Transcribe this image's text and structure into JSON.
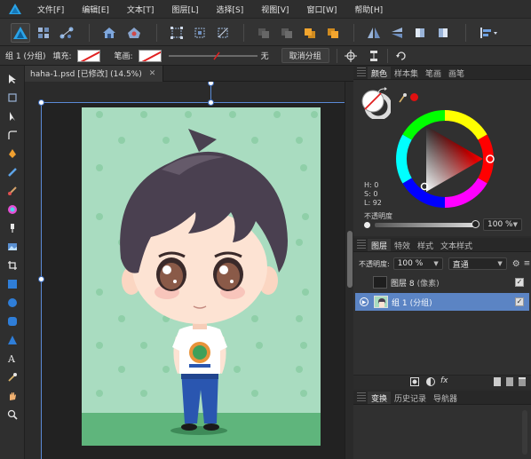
{
  "menubar": {
    "items": [
      "文件[F]",
      "编辑[E]",
      "文本[T]",
      "图层[L]",
      "选择[S]",
      "视图[V]",
      "窗口[W]",
      "帮助[H]"
    ]
  },
  "contextbar": {
    "selection_label": "组 1 (分组)",
    "fill_label": "填充:",
    "stroke_label": "笔画:",
    "stroke_value": "无",
    "ungroup_button": "取消分组"
  },
  "document": {
    "tab_title": "haha-1.psd [已修改] (14.5%)"
  },
  "color_panel": {
    "tabs": [
      "颜色",
      "样本集",
      "笔画",
      "画笔"
    ],
    "hsl": {
      "h": "H: 0",
      "s": "S: 0",
      "l": "L: 92"
    },
    "opacity_label": "不透明度",
    "opacity_value": "100 %"
  },
  "layers_panel": {
    "tabs": [
      "图层",
      "特效",
      "样式",
      "文本样式"
    ],
    "opacity_label": "不透明度:",
    "opacity_value": "100 %",
    "blend_mode": "直通",
    "layers": [
      {
        "name": "图层 8",
        "type": "(像素)",
        "selected": false
      },
      {
        "name": "组 1",
        "type": "(分组)",
        "selected": true
      }
    ]
  },
  "bottom_panel": {
    "tabs": [
      "变换",
      "历史记录",
      "导航器"
    ]
  },
  "colors": {
    "accent": "#5b84c4",
    "selection": "#5b8ad6",
    "canvas_bg": "#a9dcc0",
    "dot": "#8fcfa8",
    "ground": "#5fb57c",
    "hair": "#4a4050",
    "skin": "#fde3d3"
  }
}
